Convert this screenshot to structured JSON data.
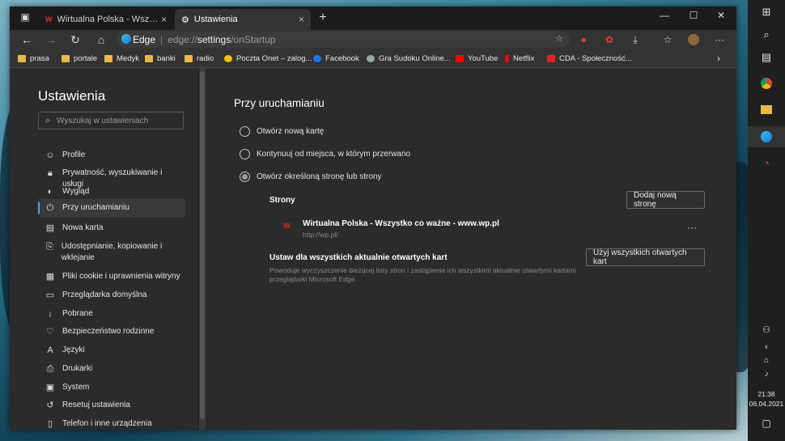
{
  "tabs": [
    {
      "label": "Wirtualna Polska - Wszystko co w",
      "close": "×"
    },
    {
      "label": "Ustawienia",
      "close": "×"
    }
  ],
  "new_tab": "+",
  "window_controls": {
    "minimize": "—",
    "maximize": "☐",
    "close": "✕"
  },
  "address": {
    "brand": "Edge",
    "separator": "|",
    "url_prefix": "edge://",
    "url_host": "settings",
    "url_path": "/onStartup"
  },
  "favorites": [
    {
      "label": "prasa",
      "icon": "folder"
    },
    {
      "label": "portale",
      "icon": "folder"
    },
    {
      "label": "Medyk",
      "icon": "folder"
    },
    {
      "label": "banki",
      "icon": "folder"
    },
    {
      "label": "radio",
      "icon": "folder"
    },
    {
      "label": "Poczta Onet – zalog...",
      "icon": "onet-icon"
    },
    {
      "label": "Facebook",
      "icon": "facebook-icon"
    },
    {
      "label": "Gra Sudoku Online...",
      "icon": "sudoku-icon"
    },
    {
      "label": "YouTube",
      "icon": "youtube-icon"
    },
    {
      "label": "Netflix",
      "icon": "netflix-icon"
    },
    {
      "label": "CDA - Społeczność...",
      "icon": "cda-icon"
    }
  ],
  "sidebar": {
    "title": "Ustawienia",
    "search_placeholder": "Wyszukaj w ustawieniach",
    "items": [
      {
        "label": "Profile",
        "icon": "profile-icon"
      },
      {
        "label": "Prywatność, wyszukiwanie i usługi",
        "icon": "lock-icon"
      },
      {
        "label": "Wygląd",
        "icon": "appearance-icon"
      },
      {
        "label": "Przy uruchamianiu",
        "icon": "power-icon",
        "active": true
      },
      {
        "label": "Nowa karta",
        "icon": "newtab-icon"
      },
      {
        "label": "Udostępnianie, kopiowanie i wklejanie",
        "icon": "share-icon"
      },
      {
        "label": "Pliki cookie i uprawnienia witryny",
        "icon": "cookie-icon"
      },
      {
        "label": "Przeglądarka domyślna",
        "icon": "browser-icon"
      },
      {
        "label": "Pobrane",
        "icon": "download-icon"
      },
      {
        "label": "Bezpieczeństwo rodzinne",
        "icon": "family-icon"
      },
      {
        "label": "Języki",
        "icon": "language-icon"
      },
      {
        "label": "Drukarki",
        "icon": "printer-icon"
      },
      {
        "label": "System",
        "icon": "system-icon"
      },
      {
        "label": "Resetuj ustawienia",
        "icon": "reset-icon"
      },
      {
        "label": "Telefon i inne urządzenia",
        "icon": "phone-icon"
      }
    ]
  },
  "main": {
    "heading": "Przy uruchamianiu",
    "options": [
      {
        "label": "Otwórz nową kartę",
        "selected": false
      },
      {
        "label": "Kontynuuj od miejsca, w którym przerwano",
        "selected": false
      },
      {
        "label": "Otwórz określoną stronę lub strony",
        "selected": true
      }
    ],
    "pages_label": "Strony",
    "add_page_button": "Dodaj nową stronę",
    "page": {
      "title": "Wirtualna Polska - Wszystko co ważne - www.wp.pl",
      "url": "http://wp.pl/",
      "more": "···"
    },
    "set_all_title": "Ustaw dla wszystkich aktualnie otwartych kart",
    "set_all_desc": "Powoduje wyczyszczenie bieżącej listy stron i zastąpienie ich wszystkimi aktualnie otwartymi kartami przeglądarki Microsoft Edge",
    "use_all_button": "Użyj wszystkich otwartych kart"
  },
  "taskbar": {
    "time": "21:38",
    "date": "06.04.2021"
  },
  "colors": {
    "accent": "#4aa3ff",
    "wp_red": "#e02a2a"
  }
}
